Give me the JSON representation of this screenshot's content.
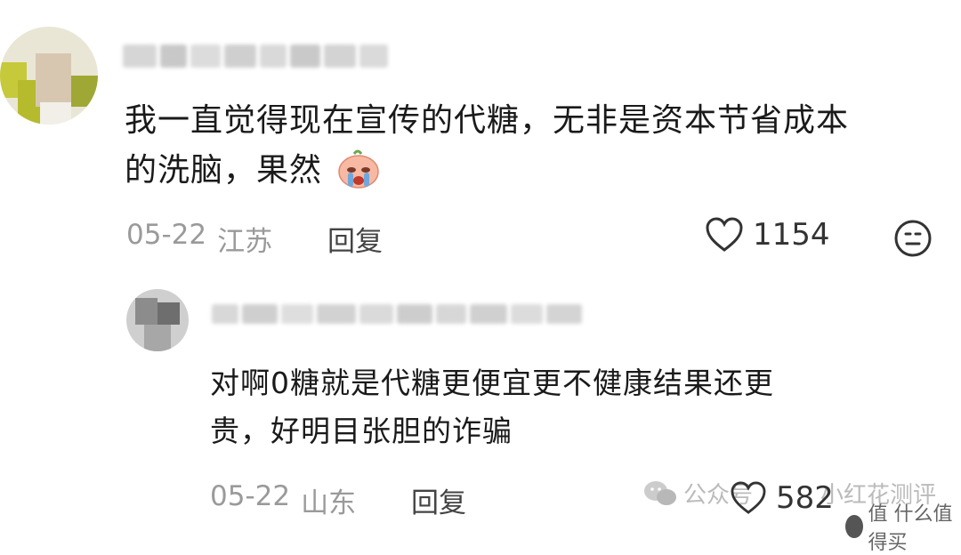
{
  "comments": [
    {
      "text_line1": "我一直觉得现在宣传的代糖，无非是资本节省成本",
      "text_line2": "的洗脑，果然",
      "date": "05-22",
      "location": "江苏",
      "reply_label": "回复",
      "likes": "1154",
      "emoji": "crying-face-emoji"
    },
    {
      "text_line1": "对啊0糖就是代糖更便宜更不健康结果还更",
      "text_line2": "贵，好明目张胆的诈骗",
      "date": "05-22",
      "location": "山东",
      "reply_label": "回复",
      "likes": "582"
    }
  ],
  "watermark": {
    "account_prefix": "公众号",
    "account_name": "小红花测评",
    "site_logo_text": "值 什么值得买"
  },
  "icons": {
    "like": "heart-outline-icon",
    "dislike": "neutral-face-icon",
    "wechat": "wechat-icon"
  },
  "colors": {
    "text": "#1a1a1a",
    "meta": "#9a9a9a",
    "watermark": "#bbbbbb"
  }
}
